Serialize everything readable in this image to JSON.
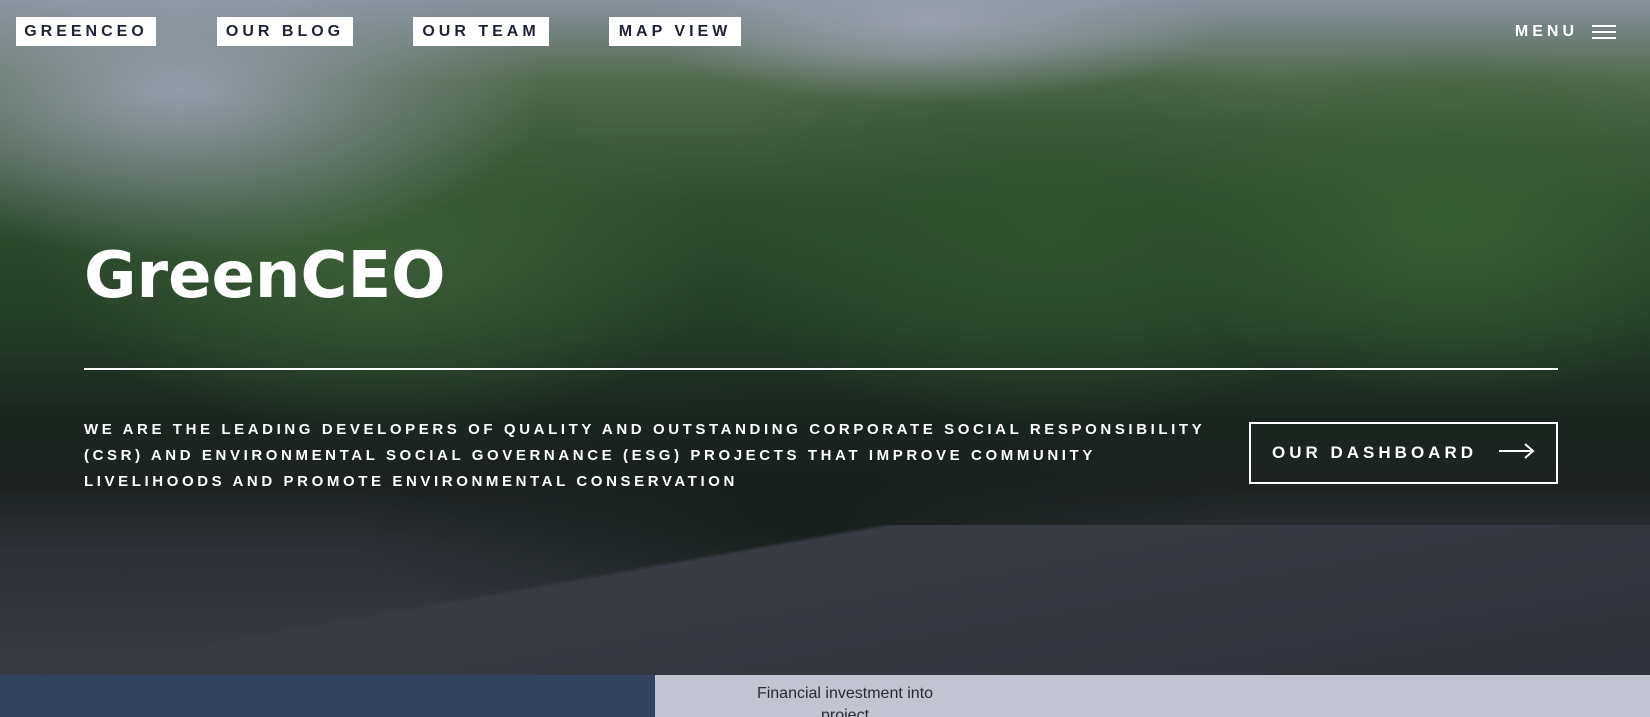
{
  "nav": {
    "home": "GREENCEO",
    "blog": "OUR BLOG",
    "team": "OUR TEAM",
    "map": "MAP VIEW",
    "menu": "MENU"
  },
  "hero": {
    "title": "GreenCEO",
    "tagline": "We are the leading developers of quality and outstanding Corporate Social Responsibility (CSR) and Environmental Social Governance (ESG) projects that improve community livelihoods and promote environmental conservation",
    "dashboard_button": "OUR DASHBOARD"
  },
  "bottom": {
    "panel_label": "Financial investment into project"
  },
  "icons": {
    "menu": "hamburger-icon",
    "arrow": "arrow-right-icon"
  },
  "colors": {
    "nav_text": "#1f2336",
    "bottom_left": "#33435f",
    "bottom_right": "#c3c3d1"
  }
}
